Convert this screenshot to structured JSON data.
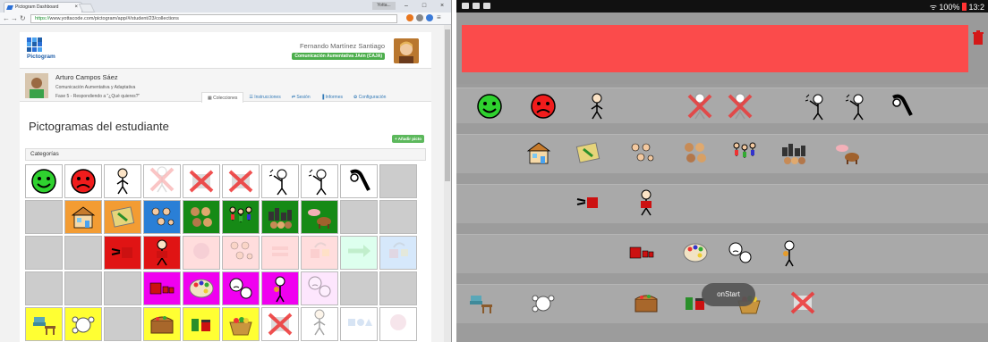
{
  "browser": {
    "tab_title": "Pictogram Dashboard",
    "tab_close": "×",
    "window_user": "Yotta...",
    "min": "–",
    "max": "□",
    "close": "×",
    "url_secure": "https://",
    "url_rest": "www.yottacode.com/pictogram/app/#/student/23/collections"
  },
  "app": {
    "logo_text": "Pictogram",
    "teacher_name": "Fernando Martínez Santiago",
    "teacher_badge": "Comunicación Aumentativa JAén (CAJA)",
    "student": {
      "name": "Arturo Campos Sáez",
      "subtitle": "Comunicación Aumentativa y Adaptativa",
      "phase": "Fase 5 - Respondiendo a \"¿Qué quieres?\""
    },
    "tabs": [
      {
        "label": "Colecciones"
      },
      {
        "label": "Instrucciones"
      },
      {
        "label": "Sesión"
      },
      {
        "label": "Informes"
      },
      {
        "label": "Configuración"
      }
    ],
    "page_title": "Pictogramas del estudiante",
    "add_button": "+ Añadir picto",
    "panel_title": "Categorías"
  },
  "android": {
    "battery": "100%",
    "time": "13:2",
    "onstart": "onStart"
  },
  "colors": {
    "red_bar": "#fb4b4b",
    "app_green": "#5cb85c",
    "link_blue": "#337ab7"
  }
}
